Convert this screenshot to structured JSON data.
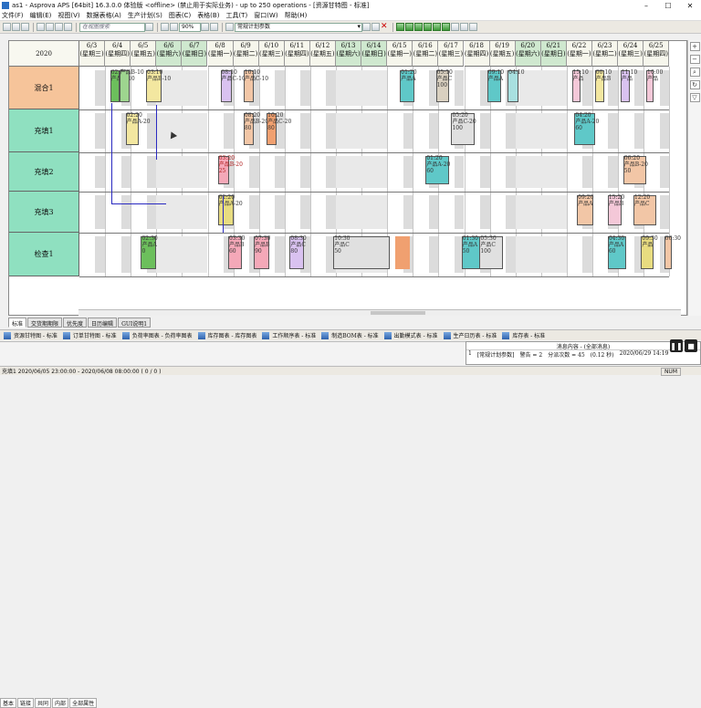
{
  "titlebar": {
    "title": "as1 - Asprova APS [64bit] 16.3.0.0 体验版 <offline> (禁止用于实际业务) - up to 250 operations - [资源甘特图 - 标准]"
  },
  "menu": [
    "文件(F)",
    "编辑(E)",
    "视图(V)",
    "数据表格(A)",
    "生产计划(S)",
    "图表(C)",
    "表格(B)",
    "工具(T)",
    "窗口(W)",
    "帮助(H)"
  ],
  "toolbar": {
    "search_placeholder": "在视图搜索",
    "zoom": "90%",
    "plan_combo": "常规计划参数"
  },
  "gantt": {
    "year": "2020",
    "dates": [
      {
        "date": "6/3",
        "dow": "(星期三)"
      },
      {
        "date": "6/4",
        "dow": "(星期四)"
      },
      {
        "date": "6/5",
        "dow": "(星期五)"
      },
      {
        "date": "6/6",
        "dow": "(星期六)"
      },
      {
        "date": "6/7",
        "dow": "(星期日)"
      },
      {
        "date": "6/8",
        "dow": "(星期一)"
      },
      {
        "date": "6/9",
        "dow": "(星期二)"
      },
      {
        "date": "6/10",
        "dow": "(星期三)"
      },
      {
        "date": "6/11",
        "dow": "(星期四)"
      },
      {
        "date": "6/12",
        "dow": "(星期五)"
      },
      {
        "date": "6/13",
        "dow": "(星期六)"
      },
      {
        "date": "6/14",
        "dow": "(星期日)"
      },
      {
        "date": "6/15",
        "dow": "(星期一)"
      },
      {
        "date": "6/16",
        "dow": "(星期二)"
      },
      {
        "date": "6/17",
        "dow": "(星期三)"
      },
      {
        "date": "6/18",
        "dow": "(星期四)"
      },
      {
        "date": "6/19",
        "dow": "(星期五)"
      },
      {
        "date": "6/20",
        "dow": "(星期六)"
      },
      {
        "date": "6/21",
        "dow": "(星期日)"
      },
      {
        "date": "6/22",
        "dow": "(星期一)"
      },
      {
        "date": "6/23",
        "dow": "(星期二)"
      },
      {
        "date": "6/24",
        "dow": "(星期三)"
      },
      {
        "date": "6/25",
        "dow": "(星期四)"
      }
    ],
    "resources": [
      {
        "name": "混合1",
        "color": "#f6c49a"
      },
      {
        "name": "充填1",
        "color": "#8fe0c0"
      },
      {
        "name": "充填2",
        "color": "#8fe0c0"
      },
      {
        "name": "充填3",
        "color": "#8fe0c0"
      },
      {
        "name": "检查1",
        "color": "#8fe0c0"
      }
    ],
    "ops": [
      {
        "label": "02:20\n产品A-10",
        "color": "#6cbf5c"
      },
      {
        "label": "产品B-10",
        "color": "#9ed58f"
      },
      {
        "label": "03:10\n产品B-10",
        "color": "#f3e7a0"
      },
      {
        "label": "08:10\n产品C-10",
        "color": "#d9c2f0"
      },
      {
        "label": "10:10\n产品C-10",
        "color": "#f2c6a6"
      },
      {
        "label": "01:20\n产品A",
        "color": "#5fc8c8"
      },
      {
        "label": "05:10\n产品C\n100",
        "color": "#d9d0c0"
      },
      {
        "label": "09:10\n产品A",
        "color": "#5fc8c8"
      },
      {
        "label": "04:10",
        "color": "#a8e0e0"
      },
      {
        "label": "15:10\n产品",
        "color": "#f4c8d8"
      },
      {
        "label": "00:10\n产品B",
        "color": "#f3e7a0"
      },
      {
        "label": "11:10\n产品",
        "color": "#d9c2f0"
      },
      {
        "label": "10:00\n产品",
        "color": "#f4c8d8"
      },
      {
        "label": "02:20\n产品A-20",
        "color": "#f3e7a0"
      },
      {
        "label": "08:20\n产品B-20\n80",
        "color": "#f2c6a6"
      },
      {
        "label": "10:20\n产品C-20\n80",
        "color": "#f0a070"
      },
      {
        "label": "05:20\n产品C-20\n100",
        "color": "#e0e0e0"
      },
      {
        "label": "04:20\n产品A-20\n60",
        "color": "#5fc8c8"
      },
      {
        "label": "03:20\n产品B-20\n25",
        "color": "#f4a8b8"
      },
      {
        "label": "01:20\n产品A-20\n60",
        "color": "#5fc8c8"
      },
      {
        "label": "06:20\n产品B-20\n50",
        "color": "#f2c6a6"
      },
      {
        "label": "02:20\n产品A-20",
        "color": "#e8dc80"
      },
      {
        "label": "09:20\n产品A",
        "color": "#f2c6a6"
      },
      {
        "label": "15:20\n产品B",
        "color": "#f4c8d8"
      },
      {
        "label": "12:20\n产品C",
        "color": "#f2c6a6"
      },
      {
        "label": "02:30\n产品A\n0",
        "color": "#6cbf5c"
      },
      {
        "label": "03:30\n产品B\n60",
        "color": "#f4a8b8"
      },
      {
        "label": "07:30\n产品B\n90",
        "color": "#f4a8b8"
      },
      {
        "label": "08:30\n产品C\n80",
        "color": "#d9c2f0"
      },
      {
        "label": "10:30\n产品C\n50",
        "color": "#e0e0e0"
      },
      {
        "label": "01:30\n产品A\n50",
        "color": "#5fc8c8"
      },
      {
        "label": "05:30\n产品C\n100",
        "color": "#e0e0e0"
      },
      {
        "label": "04:30\n产品A\n60",
        "color": "#5fc8c8"
      },
      {
        "label": "09:30\n产品",
        "color": "#e8dc80"
      },
      {
        "label": "06:30",
        "color": "#f2c6a6"
      }
    ]
  },
  "tabs": [
    "标准",
    "交货期期限",
    "优先度",
    "日历编辑",
    "GUI说明1"
  ],
  "taskbar": [
    "资源甘特图 - 标准",
    "订单甘特图 - 标准",
    "负荷率图表 - 负荷率图表",
    "库存图表 - 库存图表",
    "工作顺序表 - 标准",
    "制造BOM表 - 标准",
    "出勤模式表 - 标准",
    "生产日历表 - 标准",
    "库存表 - 标准"
  ],
  "sheet_tabs": [
    "基本",
    "链接",
    "共同",
    "内部",
    "全部属性"
  ],
  "messages": {
    "title": "消息内容 - (全部消息)",
    "row1": [
      "1",
      "[常规计划参数]",
      "警告 = 2",
      "分派次数 = 45",
      "(0.12 秒)",
      "2020/06/29 14:19"
    ]
  },
  "status": {
    "text": "充填1 2020/06/05 23:00:00 - 2020/06/08 08:00:00 ( 0 / 0 )",
    "num": "NUM"
  }
}
